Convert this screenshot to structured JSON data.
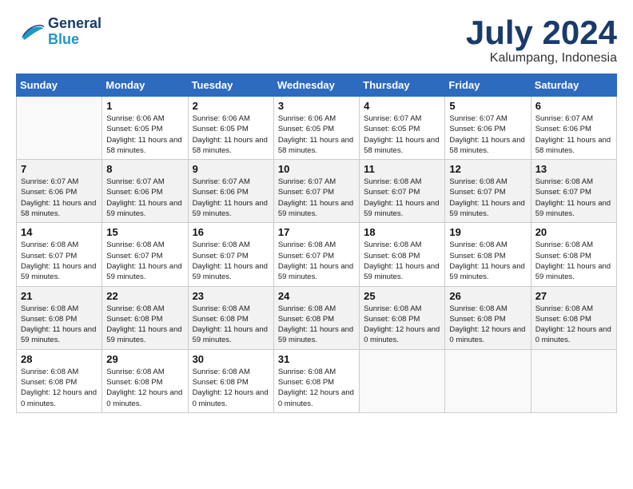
{
  "logo": {
    "line1": "General",
    "line2": "Blue"
  },
  "title": "July 2024",
  "location": "Kalumpang, Indonesia",
  "days_of_week": [
    "Sunday",
    "Monday",
    "Tuesday",
    "Wednesday",
    "Thursday",
    "Friday",
    "Saturday"
  ],
  "weeks": [
    [
      {
        "date": "",
        "sunrise": "",
        "sunset": "",
        "daylight": ""
      },
      {
        "date": "1",
        "sunrise": "Sunrise: 6:06 AM",
        "sunset": "Sunset: 6:05 PM",
        "daylight": "Daylight: 11 hours and 58 minutes."
      },
      {
        "date": "2",
        "sunrise": "Sunrise: 6:06 AM",
        "sunset": "Sunset: 6:05 PM",
        "daylight": "Daylight: 11 hours and 58 minutes."
      },
      {
        "date": "3",
        "sunrise": "Sunrise: 6:06 AM",
        "sunset": "Sunset: 6:05 PM",
        "daylight": "Daylight: 11 hours and 58 minutes."
      },
      {
        "date": "4",
        "sunrise": "Sunrise: 6:07 AM",
        "sunset": "Sunset: 6:05 PM",
        "daylight": "Daylight: 11 hours and 58 minutes."
      },
      {
        "date": "5",
        "sunrise": "Sunrise: 6:07 AM",
        "sunset": "Sunset: 6:06 PM",
        "daylight": "Daylight: 11 hours and 58 minutes."
      },
      {
        "date": "6",
        "sunrise": "Sunrise: 6:07 AM",
        "sunset": "Sunset: 6:06 PM",
        "daylight": "Daylight: 11 hours and 58 minutes."
      }
    ],
    [
      {
        "date": "7",
        "sunrise": "Sunrise: 6:07 AM",
        "sunset": "Sunset: 6:06 PM",
        "daylight": "Daylight: 11 hours and 58 minutes."
      },
      {
        "date": "8",
        "sunrise": "Sunrise: 6:07 AM",
        "sunset": "Sunset: 6:06 PM",
        "daylight": "Daylight: 11 hours and 59 minutes."
      },
      {
        "date": "9",
        "sunrise": "Sunrise: 6:07 AM",
        "sunset": "Sunset: 6:06 PM",
        "daylight": "Daylight: 11 hours and 59 minutes."
      },
      {
        "date": "10",
        "sunrise": "Sunrise: 6:07 AM",
        "sunset": "Sunset: 6:07 PM",
        "daylight": "Daylight: 11 hours and 59 minutes."
      },
      {
        "date": "11",
        "sunrise": "Sunrise: 6:08 AM",
        "sunset": "Sunset: 6:07 PM",
        "daylight": "Daylight: 11 hours and 59 minutes."
      },
      {
        "date": "12",
        "sunrise": "Sunrise: 6:08 AM",
        "sunset": "Sunset: 6:07 PM",
        "daylight": "Daylight: 11 hours and 59 minutes."
      },
      {
        "date": "13",
        "sunrise": "Sunrise: 6:08 AM",
        "sunset": "Sunset: 6:07 PM",
        "daylight": "Daylight: 11 hours and 59 minutes."
      }
    ],
    [
      {
        "date": "14",
        "sunrise": "Sunrise: 6:08 AM",
        "sunset": "Sunset: 6:07 PM",
        "daylight": "Daylight: 11 hours and 59 minutes."
      },
      {
        "date": "15",
        "sunrise": "Sunrise: 6:08 AM",
        "sunset": "Sunset: 6:07 PM",
        "daylight": "Daylight: 11 hours and 59 minutes."
      },
      {
        "date": "16",
        "sunrise": "Sunrise: 6:08 AM",
        "sunset": "Sunset: 6:07 PM",
        "daylight": "Daylight: 11 hours and 59 minutes."
      },
      {
        "date": "17",
        "sunrise": "Sunrise: 6:08 AM",
        "sunset": "Sunset: 6:07 PM",
        "daylight": "Daylight: 11 hours and 59 minutes."
      },
      {
        "date": "18",
        "sunrise": "Sunrise: 6:08 AM",
        "sunset": "Sunset: 6:08 PM",
        "daylight": "Daylight: 11 hours and 59 minutes."
      },
      {
        "date": "19",
        "sunrise": "Sunrise: 6:08 AM",
        "sunset": "Sunset: 6:08 PM",
        "daylight": "Daylight: 11 hours and 59 minutes."
      },
      {
        "date": "20",
        "sunrise": "Sunrise: 6:08 AM",
        "sunset": "Sunset: 6:08 PM",
        "daylight": "Daylight: 11 hours and 59 minutes."
      }
    ],
    [
      {
        "date": "21",
        "sunrise": "Sunrise: 6:08 AM",
        "sunset": "Sunset: 6:08 PM",
        "daylight": "Daylight: 11 hours and 59 minutes."
      },
      {
        "date": "22",
        "sunrise": "Sunrise: 6:08 AM",
        "sunset": "Sunset: 6:08 PM",
        "daylight": "Daylight: 11 hours and 59 minutes."
      },
      {
        "date": "23",
        "sunrise": "Sunrise: 6:08 AM",
        "sunset": "Sunset: 6:08 PM",
        "daylight": "Daylight: 11 hours and 59 minutes."
      },
      {
        "date": "24",
        "sunrise": "Sunrise: 6:08 AM",
        "sunset": "Sunset: 6:08 PM",
        "daylight": "Daylight: 11 hours and 59 minutes."
      },
      {
        "date": "25",
        "sunrise": "Sunrise: 6:08 AM",
        "sunset": "Sunset: 6:08 PM",
        "daylight": "Daylight: 12 hours and 0 minutes."
      },
      {
        "date": "26",
        "sunrise": "Sunrise: 6:08 AM",
        "sunset": "Sunset: 6:08 PM",
        "daylight": "Daylight: 12 hours and 0 minutes."
      },
      {
        "date": "27",
        "sunrise": "Sunrise: 6:08 AM",
        "sunset": "Sunset: 6:08 PM",
        "daylight": "Daylight: 12 hours and 0 minutes."
      }
    ],
    [
      {
        "date": "28",
        "sunrise": "Sunrise: 6:08 AM",
        "sunset": "Sunset: 6:08 PM",
        "daylight": "Daylight: 12 hours and 0 minutes."
      },
      {
        "date": "29",
        "sunrise": "Sunrise: 6:08 AM",
        "sunset": "Sunset: 6:08 PM",
        "daylight": "Daylight: 12 hours and 0 minutes."
      },
      {
        "date": "30",
        "sunrise": "Sunrise: 6:08 AM",
        "sunset": "Sunset: 6:08 PM",
        "daylight": "Daylight: 12 hours and 0 minutes."
      },
      {
        "date": "31",
        "sunrise": "Sunrise: 6:08 AM",
        "sunset": "Sunset: 6:08 PM",
        "daylight": "Daylight: 12 hours and 0 minutes."
      },
      {
        "date": "",
        "sunrise": "",
        "sunset": "",
        "daylight": ""
      },
      {
        "date": "",
        "sunrise": "",
        "sunset": "",
        "daylight": ""
      },
      {
        "date": "",
        "sunrise": "",
        "sunset": "",
        "daylight": ""
      }
    ]
  ]
}
